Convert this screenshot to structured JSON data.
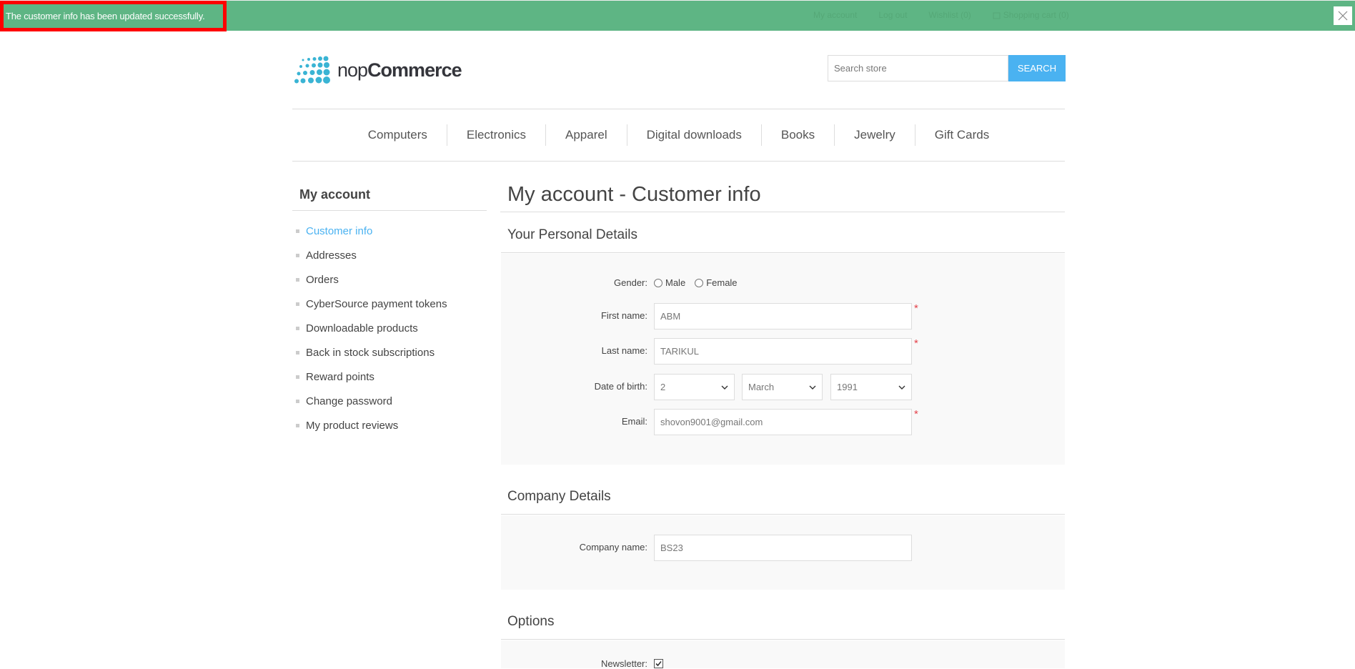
{
  "notification": {
    "message": "The customer info has been updated successfully."
  },
  "header_links": {
    "my_account": "My account",
    "log_out": "Log out",
    "wishlist": "Wishlist (0)",
    "shopping_cart": "Shopping cart (0)"
  },
  "logo": {
    "prefix": "nop",
    "suffix": "Commerce"
  },
  "search": {
    "placeholder": "Search store",
    "button_label": "SEARCH"
  },
  "menu": [
    "Computers",
    "Electronics",
    "Apparel",
    "Digital downloads",
    "Books",
    "Jewelry",
    "Gift Cards"
  ],
  "sidebar": {
    "title": "My account",
    "items": [
      "Customer info",
      "Addresses",
      "Orders",
      "CyberSource payment tokens",
      "Downloadable products",
      "Back in stock subscriptions",
      "Reward points",
      "Change password",
      "My product reviews"
    ],
    "active_index": 0
  },
  "page": {
    "title": "My account - Customer info",
    "personal_section": "Your Personal Details",
    "company_section": "Company Details",
    "options_section": "Options"
  },
  "form": {
    "gender_label": "Gender:",
    "gender_male": "Male",
    "gender_female": "Female",
    "first_name_label": "First name:",
    "first_name_value": "ABM",
    "last_name_label": "Last name:",
    "last_name_value": "TARIKUL",
    "dob_label": "Date of birth:",
    "dob_day": "2",
    "dob_month": "March",
    "dob_year": "1991",
    "email_label": "Email:",
    "email_value": "shovon9001@gmail.com",
    "company_label": "Company name:",
    "company_value": "BS23",
    "newsletter_label": "Newsletter:",
    "required_mark": "*"
  },
  "colors": {
    "notification_bg": "#5eb584",
    "accent": "#4ab2f1",
    "required": "#e4434b"
  }
}
